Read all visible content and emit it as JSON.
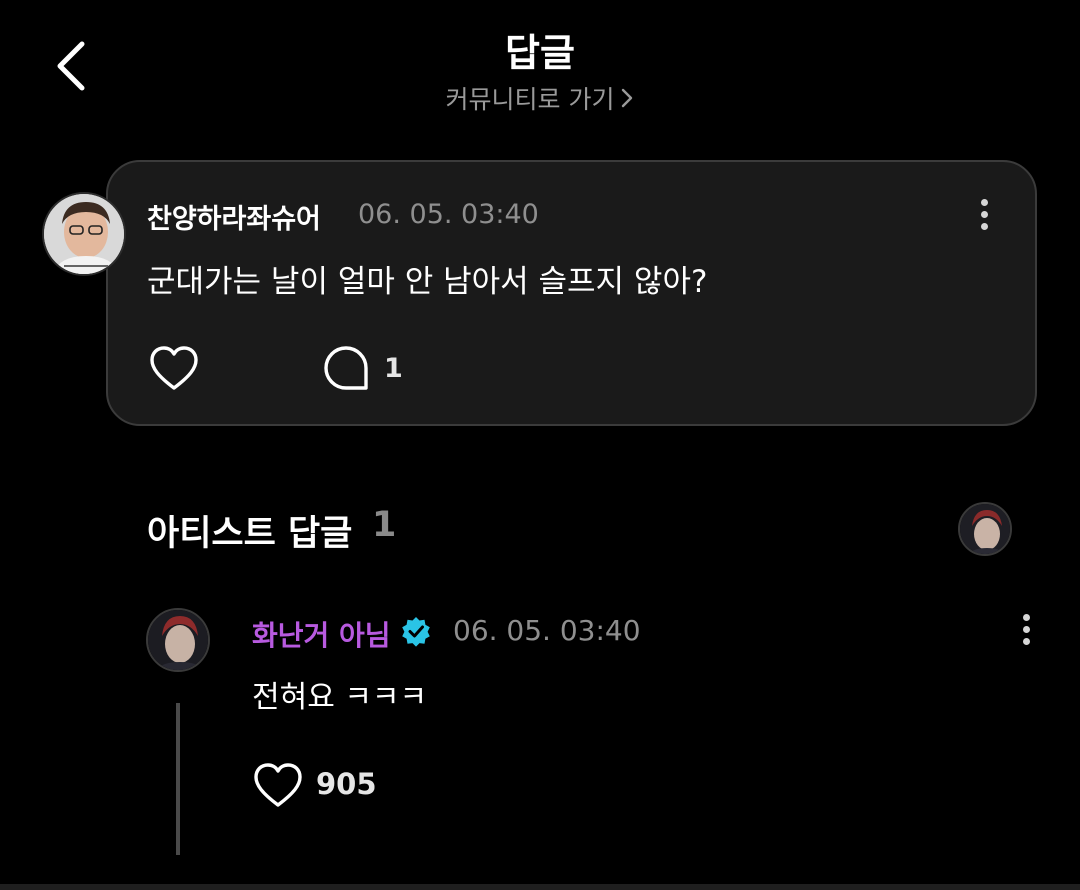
{
  "header": {
    "title": "답글",
    "community_link": "커뮤니티로 가기"
  },
  "post": {
    "author": "찬양하라좌슈어",
    "timestamp": "06. 05. 03:40",
    "text": "군대가는 날이 얼마 안 남아서 슬프지 않아?",
    "reply_count": "1",
    "icons": [
      "heart-icon",
      "speech-bubble-icon",
      "more-vertical-icon"
    ]
  },
  "artist_section": {
    "title": "아티스트 답글",
    "count": "1"
  },
  "reply": {
    "author": "화난거 아님",
    "timestamp": "06. 05. 03:40",
    "text": "전혀요 ㅋㅋㅋ",
    "like_count": "905",
    "icons": [
      "verified-badge-icon",
      "heart-icon",
      "more-vertical-icon"
    ]
  },
  "colors": {
    "background": "#000000",
    "card": "#1a1a1a",
    "artist_name": "#b85ae0",
    "verified": "#2ac4e6",
    "muted_text": "#8f8f8f"
  }
}
